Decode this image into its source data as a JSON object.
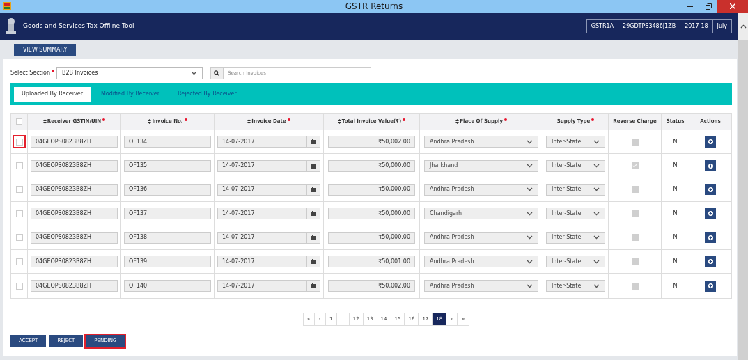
{
  "window": {
    "title": "GSTR Returns"
  },
  "header": {
    "app_name": "Goods and Services Tax Offline Tool",
    "badges": [
      "GSTR1A",
      "29GDTPS3486J1ZB",
      "2017-18",
      "July"
    ]
  },
  "view_summary_button": "VIEW SUMMARY",
  "section_select": {
    "label": "Select Section",
    "required": true,
    "value": "B2B Invoices"
  },
  "search": {
    "placeholder": "Search Invoices"
  },
  "tabs": [
    {
      "label": "Uploaded By Receiver",
      "selected": true
    },
    {
      "label": "Modified By Receiver",
      "selected": false
    },
    {
      "label": "Rejected By Receiver",
      "selected": false
    }
  ],
  "table": {
    "select_all": {
      "checked": false
    },
    "columns": [
      {
        "label": "Receiver GSTIN/UIN",
        "sortable": true,
        "required": true
      },
      {
        "label": "Invoice No.",
        "sortable": true,
        "required": true
      },
      {
        "label": "Invoice Date",
        "sortable": true,
        "required": true
      },
      {
        "label": "Total Invoice Value(₹)",
        "sortable": true,
        "required": true
      },
      {
        "label": "Place Of Supply",
        "sortable": true,
        "required": true
      },
      {
        "label": "Supply Type",
        "required": true
      },
      {
        "label": "Reverse Charge"
      },
      {
        "label": "Status"
      },
      {
        "label": "Actions"
      }
    ],
    "rows": [
      {
        "checked": false,
        "highlighted": true,
        "gstin": "04GEOPS0823B8ZH",
        "invoice_no": "OF134",
        "date": "14-07-2017",
        "value": "₹50,002.00",
        "place": "Andhra Pradesh",
        "supply_type": "Inter-State",
        "reverse_charge": false,
        "status": "N"
      },
      {
        "checked": false,
        "highlighted": false,
        "gstin": "04GEOPS0823B8ZH",
        "invoice_no": "OF135",
        "date": "14-07-2017",
        "value": "₹50,000.00",
        "place": "Jharkhand",
        "supply_type": "Inter-State",
        "reverse_charge": true,
        "status": "N"
      },
      {
        "checked": false,
        "highlighted": false,
        "gstin": "04GEOPS0823B8ZH",
        "invoice_no": "OF136",
        "date": "14-07-2017",
        "value": "₹50,000.00",
        "place": "Andhra Pradesh",
        "supply_type": "Inter-State",
        "reverse_charge": false,
        "status": "N"
      },
      {
        "checked": false,
        "highlighted": false,
        "gstin": "04GEOPS0823B8ZH",
        "invoice_no": "OF137",
        "date": "14-07-2017",
        "value": "₹50,000.00",
        "place": "Chandigarh",
        "supply_type": "Inter-State",
        "reverse_charge": false,
        "status": "N"
      },
      {
        "checked": false,
        "highlighted": false,
        "gstin": "04GEOPS0823B8ZH",
        "invoice_no": "OF138",
        "date": "14-07-2017",
        "value": "₹50,000.00",
        "place": "Andhra Pradesh",
        "supply_type": "Inter-State",
        "reverse_charge": false,
        "status": "N"
      },
      {
        "checked": false,
        "highlighted": false,
        "gstin": "04GEOPS0823B8ZH",
        "invoice_no": "OF139",
        "date": "14-07-2017",
        "value": "₹50,001.00",
        "place": "Andhra Pradesh",
        "supply_type": "Inter-State",
        "reverse_charge": false,
        "status": "N"
      },
      {
        "checked": false,
        "highlighted": false,
        "gstin": "04GEOPS0823B8ZH",
        "invoice_no": "OF140",
        "date": "14-07-2017",
        "value": "₹50,002.00",
        "place": "Andhra Pradesh",
        "supply_type": "Inter-State",
        "reverse_charge": false,
        "status": "N"
      }
    ]
  },
  "pagination": [
    {
      "label": "«",
      "selected": false
    },
    {
      "label": "‹",
      "selected": false
    },
    {
      "label": "1",
      "selected": false
    },
    {
      "label": "…",
      "selected": false
    },
    {
      "label": "12",
      "selected": false
    },
    {
      "label": "13",
      "selected": false
    },
    {
      "label": "14",
      "selected": false
    },
    {
      "label": "15",
      "selected": false
    },
    {
      "label": "16",
      "selected": false
    },
    {
      "label": "17",
      "selected": false
    },
    {
      "label": "18",
      "selected": true
    },
    {
      "label": "›",
      "selected": false
    },
    {
      "label": "»",
      "selected": false
    }
  ],
  "actions": [
    {
      "label": "ACCEPT",
      "highlighted": false
    },
    {
      "label": "REJECT",
      "highlighted": false
    },
    {
      "label": "PENDING",
      "highlighted": true
    }
  ]
}
